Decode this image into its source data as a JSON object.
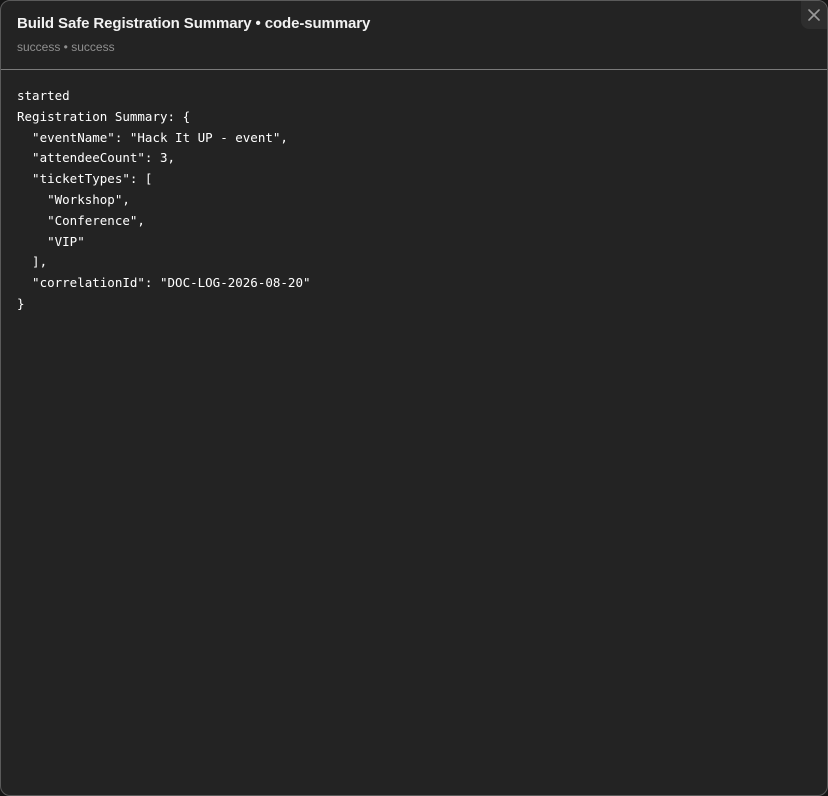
{
  "dialog": {
    "title": "Build Safe Registration Summary • code-summary",
    "subtitle": "success • success",
    "close_icon": "close-icon"
  },
  "log": {
    "lines": [
      "started",
      "Registration Summary: {",
      "  \"eventName\": \"Hack It UP - event\",",
      "  \"attendeeCount\": 3,",
      "  \"ticketTypes\": [",
      "    \"Workshop\",",
      "    \"Conference\",",
      "    \"VIP\"",
      "  ],",
      "  \"correlationId\": \"DOC-LOG-2026-08-20\"",
      "}"
    ]
  }
}
